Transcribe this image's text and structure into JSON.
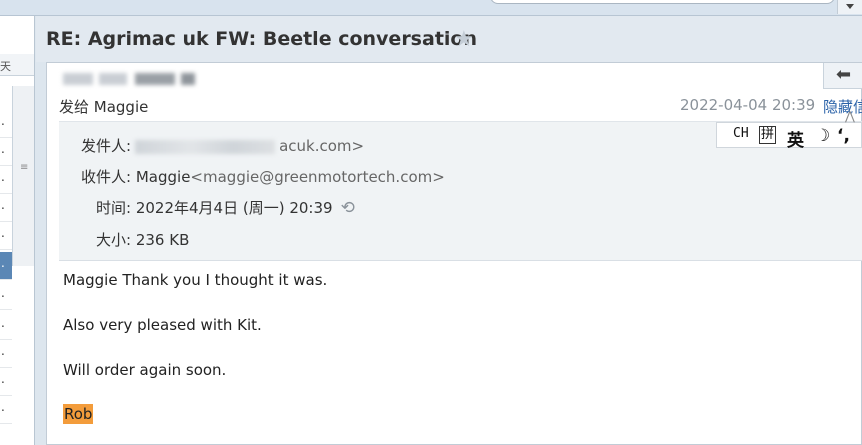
{
  "window": {
    "subject": "RE: Agrimac uk FW: Beetle conversation"
  },
  "left_list": {
    "header_fragment": "天",
    "row_marker": ".",
    "splitter_glyph": "≡"
  },
  "message": {
    "sent_to": "发给 Maggie",
    "date": "2022-04-04 20:39",
    "hide_link": "隐藏信",
    "details": {
      "from_label": "发件人:",
      "from_visible": "acuk.com>",
      "to_label": "收件人:",
      "to_name": "Maggie",
      "to_email": "<maggie@greenmotortech.com>",
      "time_label": "时间:",
      "time_value": "2022年4月4日 (周一) 20:39",
      "size_label": "大小:",
      "size_value": "236 KB"
    },
    "body": [
      "Maggie Thank you  I thought it was.",
      "Also very pleased with Kit.",
      "Will order again soon."
    ],
    "signature": "Rob"
  },
  "ime": {
    "ch": "CH",
    "pin": "拼",
    "ying": "英",
    "moon": "☽",
    "punct": "‘,"
  }
}
